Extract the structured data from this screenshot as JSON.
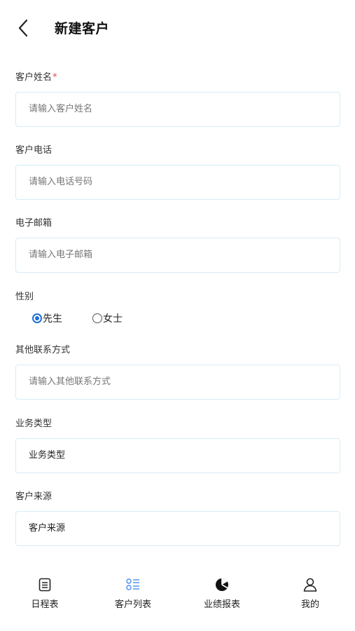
{
  "header": {
    "title": "新建客户"
  },
  "form": {
    "name": {
      "label": "客户姓名",
      "required_mark": "*",
      "placeholder": "请输入客户姓名"
    },
    "phone": {
      "label": "客户电话",
      "placeholder": "请输入电话号码"
    },
    "email": {
      "label": "电子邮箱",
      "placeholder": "请输入电子邮箱"
    },
    "gender": {
      "label": "性别",
      "options": [
        {
          "label": "先生",
          "checked": true
        },
        {
          "label": "女士",
          "checked": false
        }
      ]
    },
    "other_contact": {
      "label": "其他联系方式",
      "placeholder": "请输入其他联系方式"
    },
    "business_type": {
      "label": "业务类型",
      "value": "业务类型"
    },
    "source": {
      "label": "客户来源",
      "value": "客户来源"
    }
  },
  "tabbar": {
    "items": [
      {
        "label": "日程表",
        "icon": "calendar-list-icon"
      },
      {
        "label": "客户列表",
        "icon": "customer-list-icon",
        "active": true
      },
      {
        "label": "业绩报表",
        "icon": "pie-chart-icon"
      },
      {
        "label": "我的",
        "icon": "person-icon"
      }
    ]
  },
  "colors": {
    "accent": "#1e6fd9",
    "field_border": "#d6ecf8",
    "required": "#e5484d"
  }
}
